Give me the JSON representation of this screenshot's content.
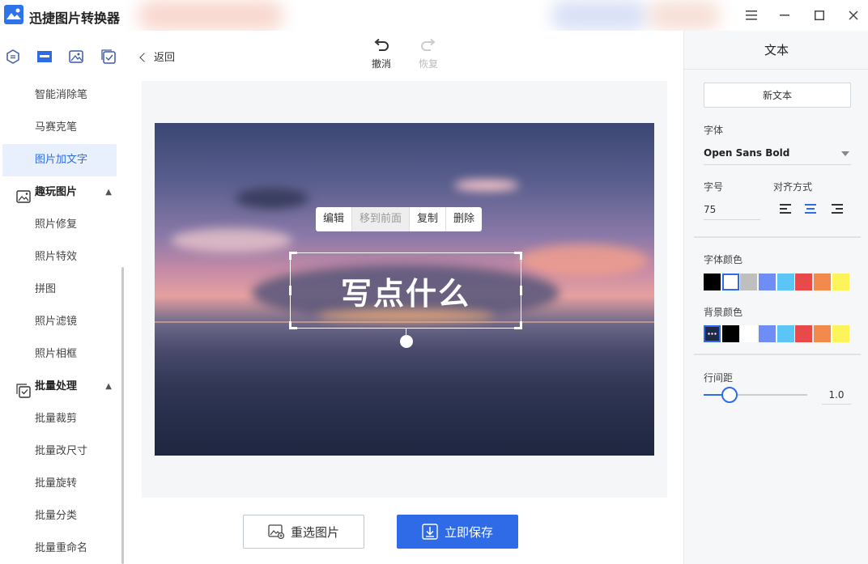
{
  "app": {
    "title": "迅捷图片转换器",
    "logo_icon": "app-logo-icon"
  },
  "window_controls": [
    {
      "name": "menu-icon",
      "glyph": "☰"
    },
    {
      "name": "minimize-icon",
      "glyph": "—"
    },
    {
      "name": "maximize-icon",
      "glyph": "☐"
    },
    {
      "name": "close-icon",
      "glyph": "✕"
    }
  ],
  "sidebar": {
    "tool_icons": [
      "convert-icon",
      "image-edit-icon",
      "picture-icon",
      "batch-check-icon"
    ],
    "items_top": [
      {
        "label": "智能消除笔",
        "active": false
      },
      {
        "label": "马赛克笔",
        "active": false
      },
      {
        "label": "图片加文字",
        "active": true
      }
    ],
    "group_fun": {
      "label": "趣玩图片",
      "icon": "fun-image-icon",
      "caret": "▲"
    },
    "items_fun": [
      "照片修复",
      "照片特效",
      "拼图",
      "照片滤镜",
      "照片相框"
    ],
    "group_batch": {
      "label": "批量处理",
      "icon": "batch-icon",
      "caret": "▲"
    },
    "items_batch": [
      "批量裁剪",
      "批量改尺寸",
      "批量旋转",
      "批量分类",
      "批量重命名"
    ]
  },
  "main": {
    "back_label": "返回",
    "undo_label": "撤消",
    "redo_label": "恢复",
    "context_menu": [
      "编辑",
      "移到前面",
      "复制",
      "删除"
    ],
    "overlay_text": "写点什么",
    "reselect_label": "重选图片",
    "save_label": "立即保存"
  },
  "panel": {
    "title": "文本",
    "new_text_label": "新文本",
    "font_label": "字体",
    "font_value": "Open Sans Bold",
    "size_label": "字号",
    "size_value": "75",
    "align_label": "对齐方式",
    "align_options": [
      "align-left-icon",
      "align-center-icon",
      "align-right-icon"
    ],
    "align_selected": "align-center-icon",
    "font_color_label": "字体颜色",
    "font_colors": [
      "#000000",
      "#ffffff",
      "#bfbfbf",
      "#6e8ef5",
      "#5bc6f5",
      "#e84a4a",
      "#f28a4e",
      "#fdf35a"
    ],
    "font_color_selected": "#ffffff",
    "bg_color_label": "背景颜色",
    "bg_colors": [
      "transparent-more",
      "#000000",
      "#ffffff",
      "#6e8ef5",
      "#5bc6f5",
      "#e84a4a",
      "#f28a4e",
      "#fdf35a"
    ],
    "line_spacing_label": "行间距",
    "line_spacing_value": "1.0"
  },
  "colors": {
    "accent": "#2f6be6",
    "active_bg": "#e9f0fd"
  }
}
